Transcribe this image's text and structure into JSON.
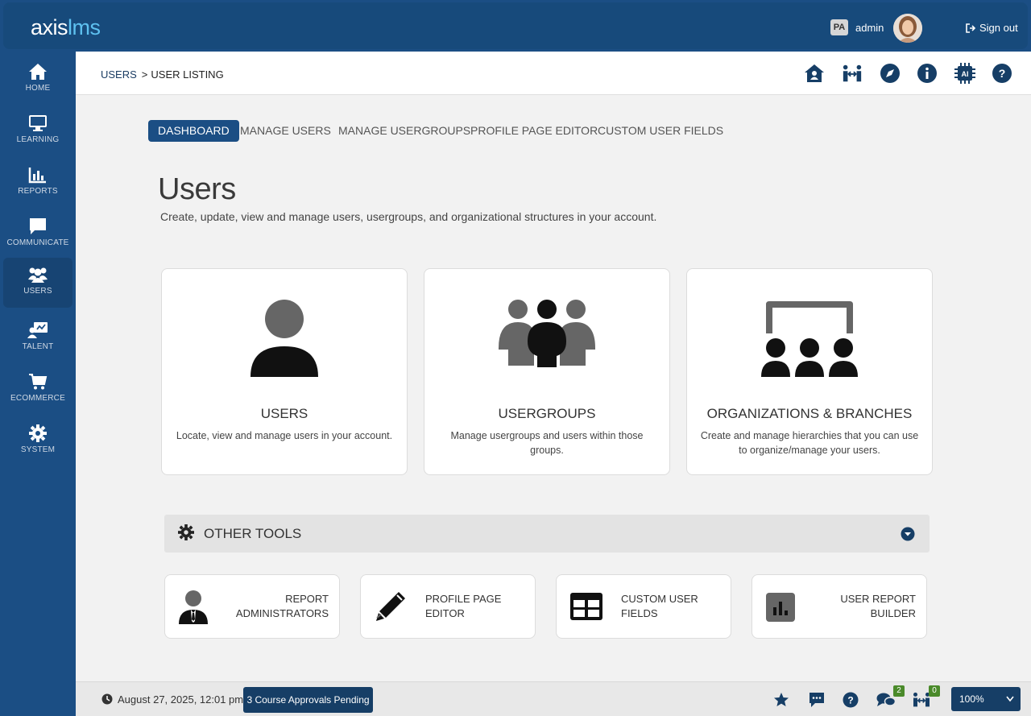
{
  "app": {
    "logo_main": "axis",
    "logo_accent": "lms"
  },
  "user": {
    "initials": "PA",
    "name": "admin",
    "signout_label": "Sign out"
  },
  "sidebar": {
    "items": [
      {
        "label": "HOME",
        "icon": "home-icon"
      },
      {
        "label": "LEARNING",
        "icon": "monitor-icon"
      },
      {
        "label": "REPORTS",
        "icon": "chart-icon"
      },
      {
        "label": "COMMUNICATE",
        "icon": "chat-icon"
      },
      {
        "label": "USERS",
        "icon": "users-icon",
        "active": true
      },
      {
        "label": "TALENT",
        "icon": "talent-icon"
      },
      {
        "label": "ECOMMERCE",
        "icon": "cart-icon"
      },
      {
        "label": "SYSTEM",
        "icon": "gear-icon"
      }
    ]
  },
  "breadcrumb": {
    "parent": "USERS",
    "separator": ">",
    "current": "USER LISTING"
  },
  "tabs": [
    {
      "label": "DASHBOARD",
      "active": true
    },
    {
      "label": "MANAGE USERS"
    },
    {
      "label": "MANAGE USERGROUPS"
    },
    {
      "label": "PROFILE PAGE EDITOR"
    },
    {
      "label": "CUSTOM USER FIELDS"
    }
  ],
  "page": {
    "title": "Users",
    "description": "Create, update, view and manage users, usergroups, and organizational structures in your account."
  },
  "cards": [
    {
      "title": "USERS",
      "description": "Locate, view and manage users in your account."
    },
    {
      "title": "USERGROUPS",
      "description": "Manage usergroups and users within those groups."
    },
    {
      "title": "ORGANIZATIONS & BRANCHES",
      "description": "Create and manage hierarchies that you can use to organize/manage your users."
    }
  ],
  "other_tools": {
    "label": "OTHER TOOLS",
    "items": [
      {
        "line1": "REPORT",
        "line2": "ADMINISTRATORS"
      },
      {
        "line1": "PROFILE PAGE EDITOR",
        "line2": ""
      },
      {
        "line1": "CUSTOM USER FIELDS",
        "line2": ""
      },
      {
        "line1": "USER REPORT",
        "line2": "BUILDER"
      }
    ]
  },
  "footer": {
    "datetime": "August 27, 2025, 12:01 pm",
    "pending": "3 Course Approvals Pending",
    "messages_count": "2",
    "connections_count": "0",
    "zoom": "100%"
  },
  "colors": {
    "primary": "#1b4e84",
    "accent": "#5ec1f0",
    "badge": "#4a8a2a"
  }
}
